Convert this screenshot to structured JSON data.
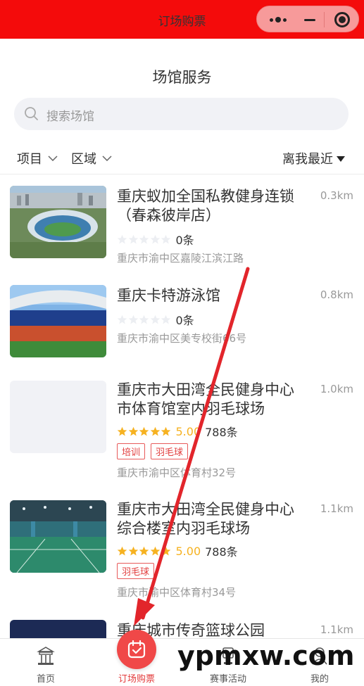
{
  "topbar": {
    "title": "订场购票",
    "bg_color": "#f40b0b"
  },
  "page": {
    "title": "场馆服务"
  },
  "search": {
    "placeholder": "搜索场馆"
  },
  "filters": {
    "project": "项目",
    "area": "区域",
    "sort": "离我最近"
  },
  "venues": [
    {
      "name": "重庆蚁加全国私教健身连锁（春森彼岸店）",
      "distance": "0.3km",
      "count": "0条",
      "address": "重庆市渝中区嘉陵江滨江路",
      "tags": [],
      "stars": 0
    },
    {
      "name": "重庆卡特游泳馆",
      "distance": "0.8km",
      "count": "0条",
      "address": "重庆市渝中区美专校街66号",
      "tags": [],
      "stars": 0
    },
    {
      "name": "重庆市大田湾全民健身中心市体育馆室内羽毛球场",
      "distance": "1.0km",
      "score": "5.00",
      "count": "788条",
      "address": "重庆市渝中区体育村32号",
      "tags": [
        "培训",
        "羽毛球"
      ],
      "stars": 5
    },
    {
      "name": "重庆市大田湾全民健身中心综合楼室内羽毛球场",
      "distance": "1.1km",
      "score": "5.00",
      "count": "788条",
      "address": "重庆市渝中区体育村34号",
      "tags": [
        "羽毛球"
      ],
      "stars": 5
    },
    {
      "name": "重庆城市传奇篮球公园",
      "distance": "1.1km"
    }
  ],
  "tabbar": {
    "home": "首页",
    "tickets": "订场购票",
    "events": "赛事活动",
    "me": "我的"
  },
  "watermark": "ypmxw.com"
}
